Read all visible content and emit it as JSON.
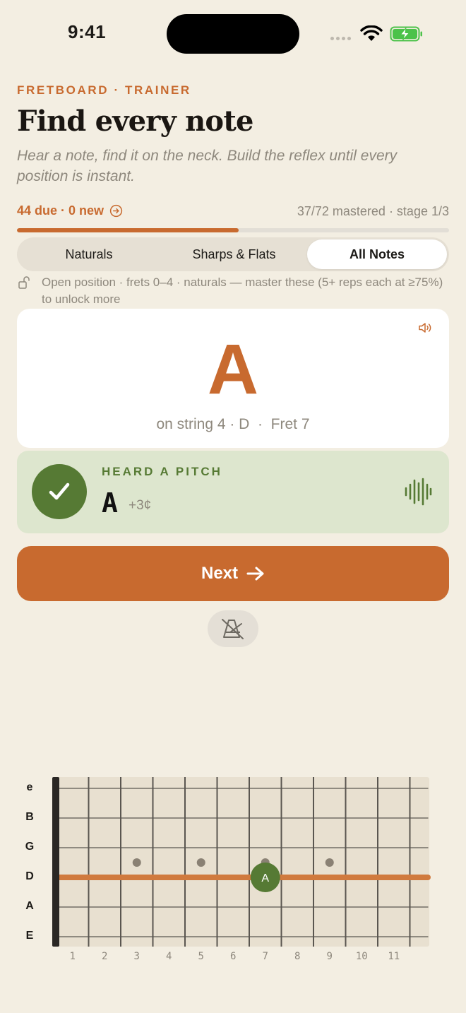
{
  "status": {
    "time": "9:41"
  },
  "header": {
    "eyebrow": "FRETBOARD · TRAINER",
    "title": "Find every note",
    "subtitle": "Hear a note, find it on the neck. Build the reflex until every position is instant."
  },
  "progress": {
    "due_text": "44 due · 0 new",
    "mastered_text": "37/72 mastered · stage 1/3",
    "fraction": 0.513
  },
  "tabs": [
    {
      "label": "Naturals",
      "active": false
    },
    {
      "label": "Sharps & Flats",
      "active": false
    },
    {
      "label": "All Notes",
      "active": true
    }
  ],
  "unlock_note": "Open position · frets 0–4 · naturals — master these (5+ reps each at ≥75%) to unlock more",
  "prompt_card": {
    "note": "A",
    "detail": "on string 4 · D  ·  Fret 7"
  },
  "heard": {
    "label": "HEARD A PITCH",
    "note": "A",
    "cents": "+3¢"
  },
  "next_button": {
    "label": "Next"
  },
  "fretboard": {
    "strings": [
      "e",
      "B",
      "G",
      "D",
      "A",
      "E"
    ],
    "fret_numbers": [
      "1",
      "2",
      "3",
      "4",
      "5",
      "6",
      "7",
      "8",
      "9",
      "10",
      "11"
    ],
    "inlay_frets": [
      3,
      5,
      7,
      9
    ],
    "highlight_string": "D",
    "marker": {
      "fret": 7,
      "string": "D",
      "label": "A"
    }
  },
  "colors": {
    "accent": "#C86A2F",
    "success": "#567A34",
    "background": "#F3EEE2"
  }
}
